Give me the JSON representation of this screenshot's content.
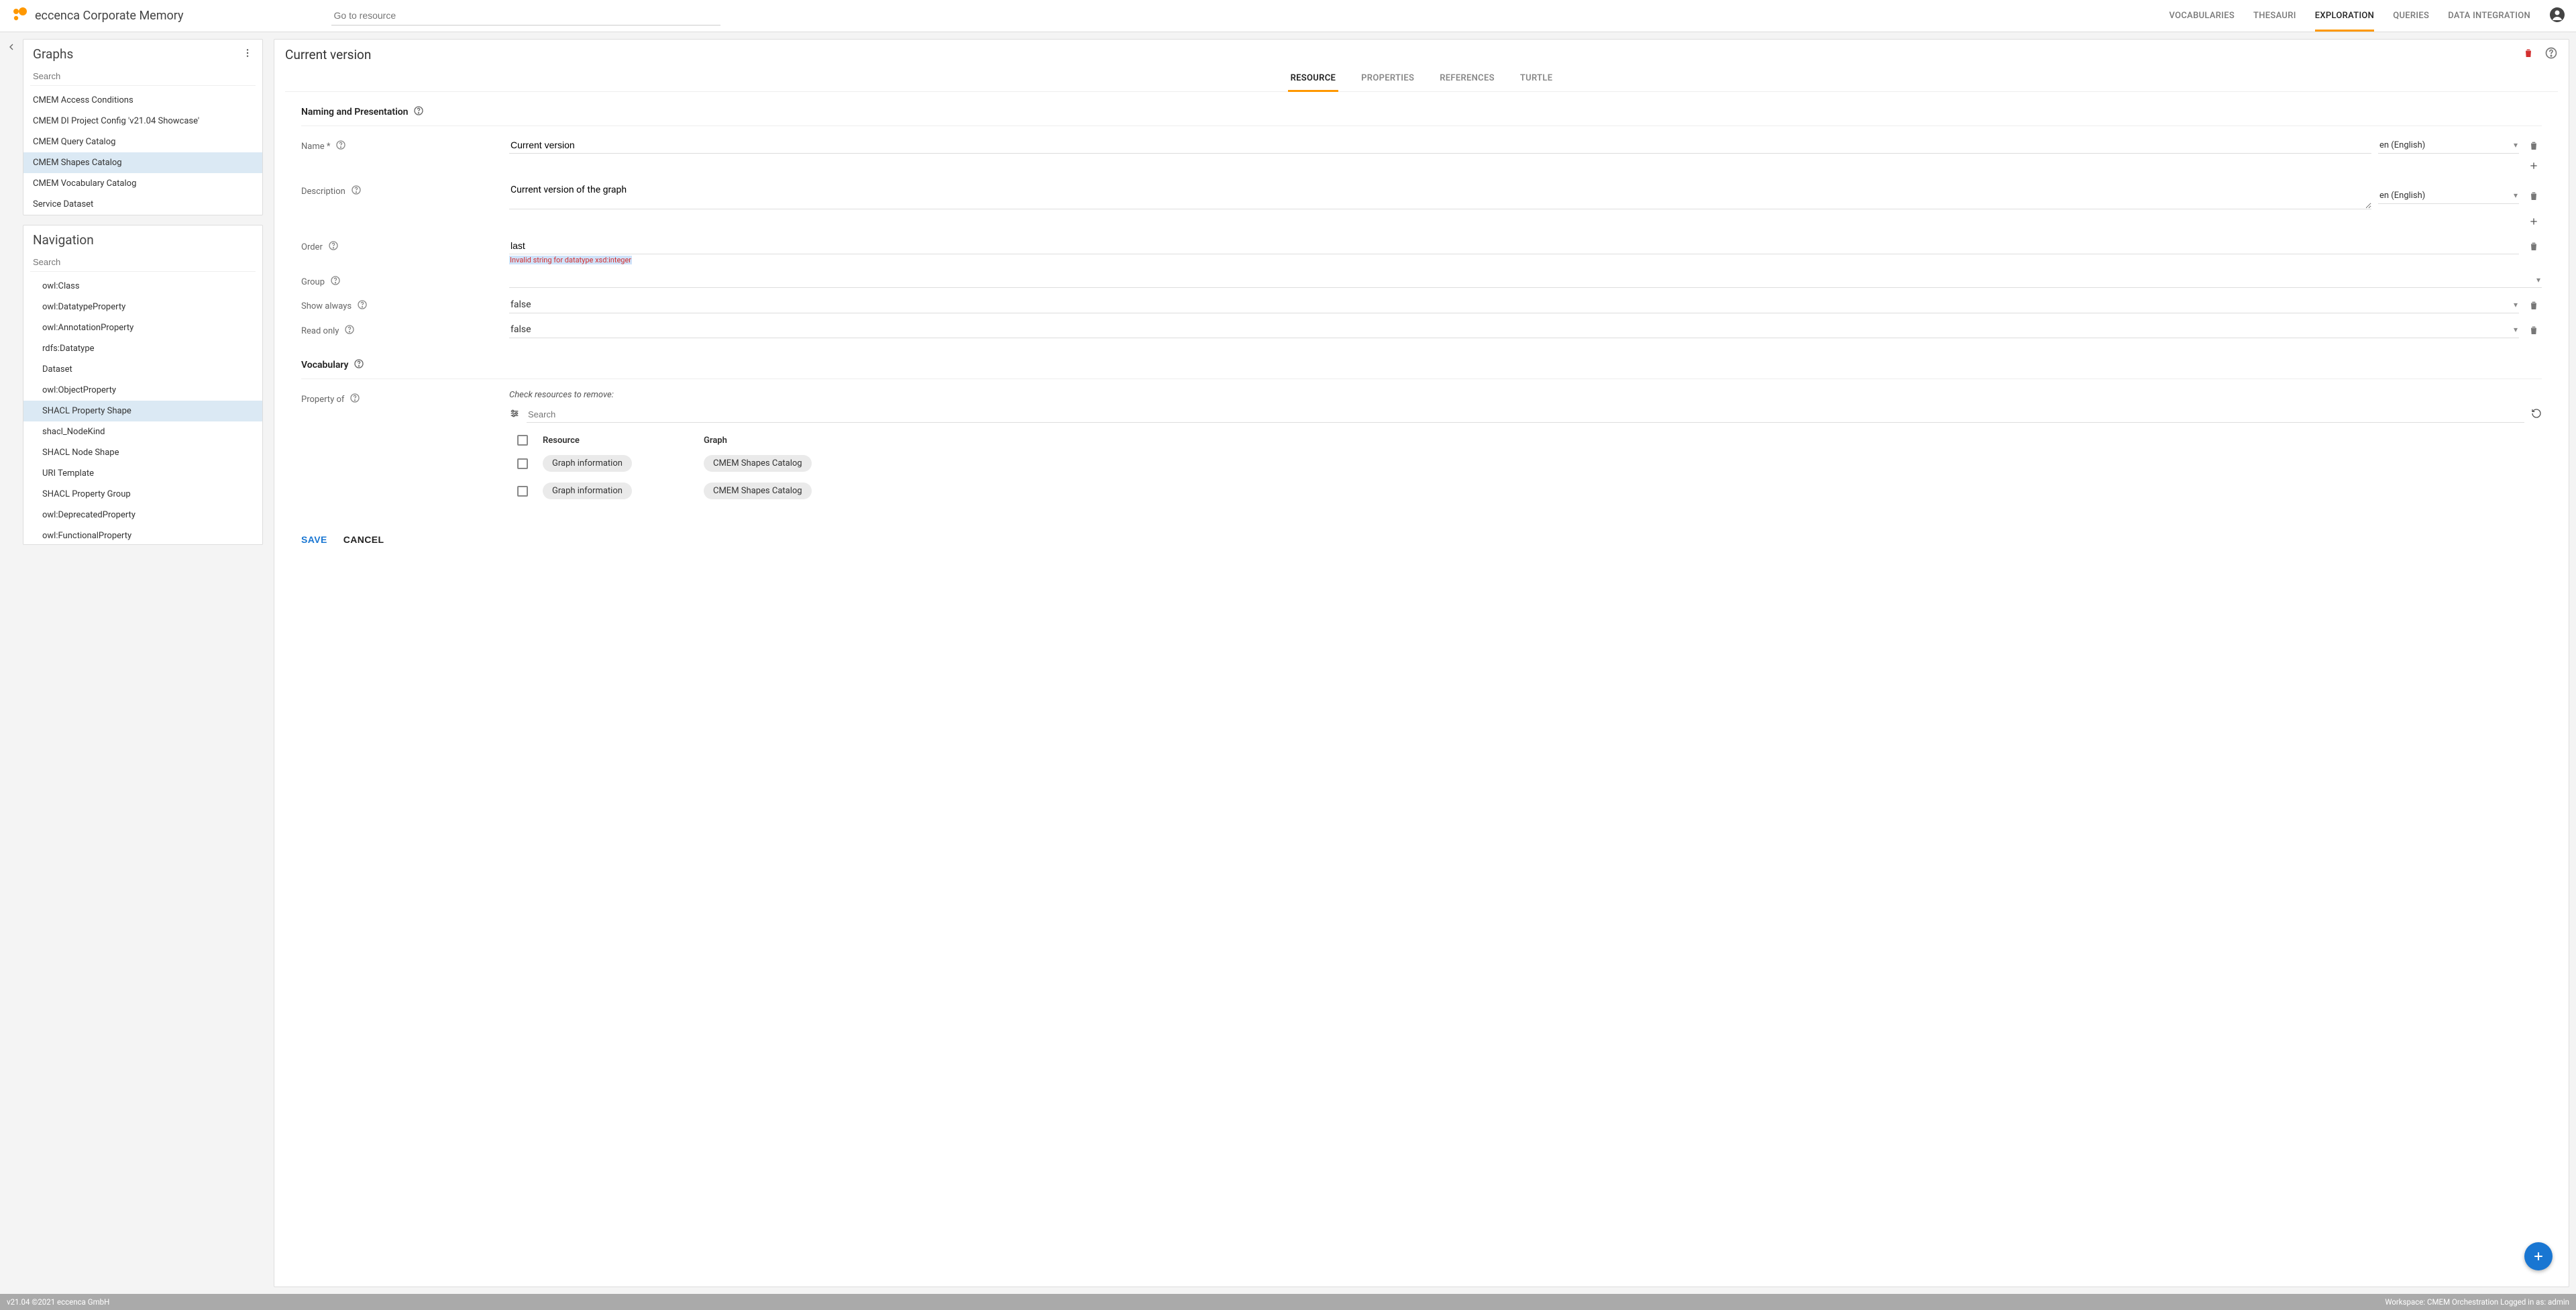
{
  "header": {
    "brand": "eccenca Corporate Memory",
    "go_to_placeholder": "Go to resource",
    "nav": {
      "vocabularies": "VOCABULARIES",
      "thesauri": "THESAURI",
      "exploration": "EXPLORATION",
      "queries": "QUERIES",
      "data_integration": "DATA INTEGRATION"
    }
  },
  "sidebar": {
    "graphs": {
      "title": "Graphs",
      "search_placeholder": "Search",
      "items": [
        "CMEM Access Conditions",
        "CMEM DI Project Config 'v21.04 Showcase'",
        "CMEM Query Catalog",
        "CMEM Shapes Catalog",
        "CMEM Vocabulary Catalog",
        "Service Dataset"
      ],
      "selected_index": 3
    },
    "navigation": {
      "title": "Navigation",
      "search_placeholder": "Search",
      "items": [
        "owl:Class",
        "owl:DatatypeProperty",
        "owl:AnnotationProperty",
        "rdfs:Datatype",
        "Dataset",
        "owl:ObjectProperty",
        "SHACL Property Shape",
        "shacl_NodeKind",
        "SHACL Node Shape",
        "URI Template",
        "SHACL Property Group",
        "owl:DeprecatedProperty",
        "owl:FunctionalProperty"
      ],
      "selected_index": 6
    }
  },
  "main": {
    "title": "Current version",
    "tabs": {
      "resource": "RESOURCE",
      "properties": "PROPERTIES",
      "references": "REFERENCES",
      "turtle": "TURTLE"
    },
    "sections": {
      "naming": "Naming and Presentation",
      "vocabulary": "Vocabulary"
    },
    "fields": {
      "name": {
        "label": "Name *",
        "value": "Current version",
        "lang": "en (English)"
      },
      "description": {
        "label": "Description",
        "value": "Current version of the graph",
        "lang": "en (English)"
      },
      "order": {
        "label": "Order",
        "value": "last",
        "error": "Invalid string for datatype xsd:integer"
      },
      "group": {
        "label": "Group",
        "value": ""
      },
      "show_always": {
        "label": "Show always",
        "value": "false"
      },
      "read_only": {
        "label": "Read only",
        "value": "false"
      },
      "property_of": {
        "label": "Property of",
        "hint": "Check resources to remove:",
        "search_placeholder": "Search"
      }
    },
    "resource_table": {
      "headers": {
        "resource": "Resource",
        "graph": "Graph"
      },
      "rows": [
        {
          "resource": "Graph information",
          "graph": "CMEM Shapes Catalog"
        },
        {
          "resource": "Graph information",
          "graph": "CMEM Shapes Catalog"
        }
      ]
    },
    "actions": {
      "save": "SAVE",
      "cancel": "CANCEL"
    }
  },
  "footer": {
    "left": "v21.04 ©2021   eccenca GmbH",
    "right": "Workspace: CMEM Orchestration  Logged in as: admin"
  }
}
